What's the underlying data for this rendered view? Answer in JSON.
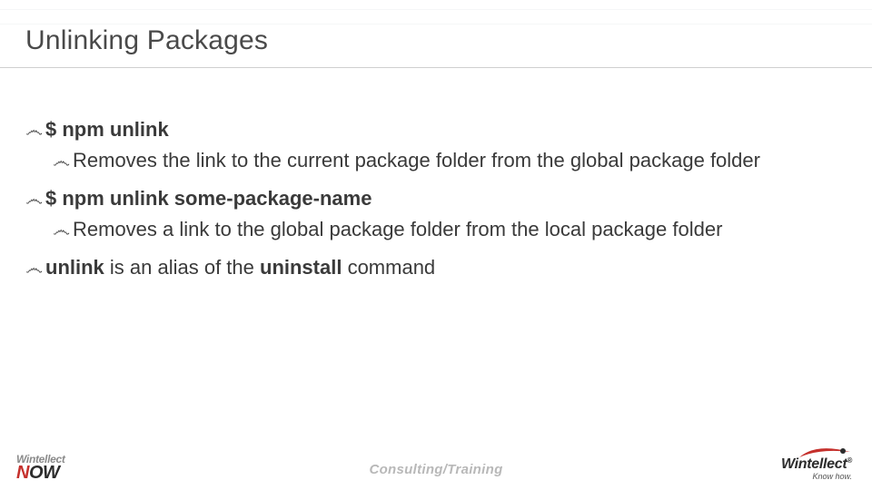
{
  "title": "Unlinking Packages",
  "bullets": [
    {
      "cmd": "$ npm unlink",
      "desc": "Removes the link to the current package folder from the global package folder"
    },
    {
      "cmd": "$ npm unlink some-package-name",
      "desc": "Removes a link to the global package folder from the local package folder"
    }
  ],
  "final": {
    "pre": "unlink",
    "mid": " is an alias of the ",
    "bold2": "uninstall",
    "post": " command"
  },
  "footer": {
    "center": "Consulting/Training",
    "left_top": "Wintellect",
    "left_now": "NOW",
    "right_brand": "Wintellect",
    "right_reg": "®",
    "right_tag": "Know how."
  },
  "glyph": "෴"
}
